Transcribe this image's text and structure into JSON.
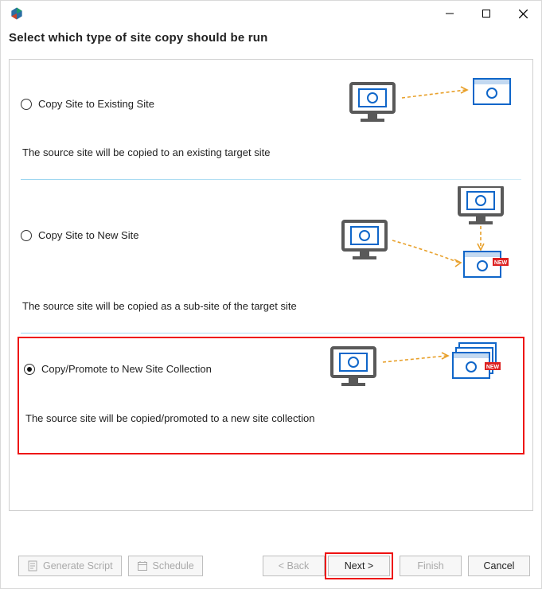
{
  "window": {
    "title": "Select which type of site copy should be run"
  },
  "options": [
    {
      "label": "Copy Site to Existing Site",
      "desc": "The source site will be copied to an existing target site",
      "selected": false
    },
    {
      "label": "Copy Site to New Site",
      "desc": "The source site will be copied as a sub-site of the target site",
      "selected": false
    },
    {
      "label": "Copy/Promote to New Site Collection",
      "desc": "The source site will be copied/promoted to a new site collection",
      "selected": true
    }
  ],
  "footer": {
    "generate_script": "Generate Script",
    "schedule": "Schedule",
    "back": "<  Back",
    "next": "Next  >",
    "finish": "Finish",
    "cancel": "Cancel"
  },
  "icons": {
    "app": "app-logo-icon",
    "minimize": "minimize-icon",
    "maximize": "maximize-icon",
    "close": "close-icon",
    "script": "script-icon",
    "schedule": "schedule-icon"
  }
}
